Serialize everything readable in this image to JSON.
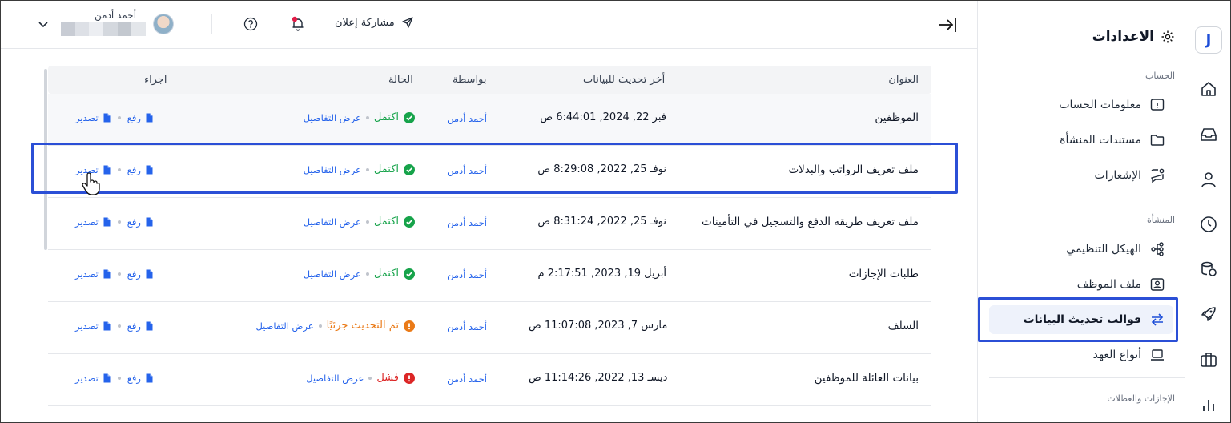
{
  "header": {
    "share_label": "مشاركة إعلان",
    "user_name": "أحمد أدمن"
  },
  "sidebar": {
    "title": "الاعدادات",
    "sections": {
      "account": "الحساب",
      "organization": "المنشأة",
      "leaves": "الإجازات والعطلات"
    },
    "items": [
      {
        "label": "معلومات الحساب",
        "icon": "info-icon"
      },
      {
        "label": "مستندات المنشأة",
        "icon": "folder-icon"
      },
      {
        "label": "الإشعارات",
        "icon": "notification-icon"
      },
      {
        "label": "الهيكل التنظيمي",
        "icon": "org-chart-icon"
      },
      {
        "label": "ملف الموظف",
        "icon": "id-card-icon"
      },
      {
        "label": "قوالب تحديث البيانات",
        "icon": "swap-arrows-icon",
        "active": true
      },
      {
        "label": "أنواع العهد",
        "icon": "laptop-icon"
      }
    ]
  },
  "table": {
    "columns": {
      "title": "العنوان",
      "last_update": "أخر تحديث للبيانات",
      "by": "بواسطة",
      "status": "الحالة",
      "action": "اجراء"
    },
    "details_label": "عرض التفاصيل",
    "upload_label": "رفع",
    "export_label": "تصدير",
    "rows": [
      {
        "title": "الموظفين",
        "date": "فبر 22, 2024, 6:44:01 ص",
        "by": "أحمد أدمن",
        "status": "اكتمل",
        "status_type": "ok"
      },
      {
        "title": "ملف تعريف الرواتب والبدلات",
        "date": "نوفـ 25, 2022, 8:29:08 ص",
        "by": "أحمد أدمن",
        "status": "اكتمل",
        "status_type": "ok"
      },
      {
        "title": "ملف تعريف طريقة الدفع والتسجيل في التأمينات",
        "date": "نوفـ 25, 2022, 8:31:24 ص",
        "by": "أحمد أدمن",
        "status": "اكتمل",
        "status_type": "ok"
      },
      {
        "title": "طلبات الإجازات",
        "date": "أبريل 19, 2023, 2:17:51 م",
        "by": "أحمد أدمن",
        "status": "اكتمل",
        "status_type": "ok"
      },
      {
        "title": "السلف",
        "date": "مارس 7, 2023, 11:07:08 ص",
        "by": "أحمد أدمن",
        "status": "تم التحديث جزئيًا",
        "status_type": "warn"
      },
      {
        "title": "بيانات العائلة للموظفين",
        "date": "ديسـ 13, 2022, 11:14:26 ص",
        "by": "أحمد أدمن",
        "status": "فشل",
        "status_type": "fail"
      }
    ]
  },
  "colors": {
    "accent": "#2563eb",
    "success": "#16a34a",
    "warning": "#ea7a17",
    "danger": "#dc2626",
    "highlight": "#2b4fd6"
  }
}
